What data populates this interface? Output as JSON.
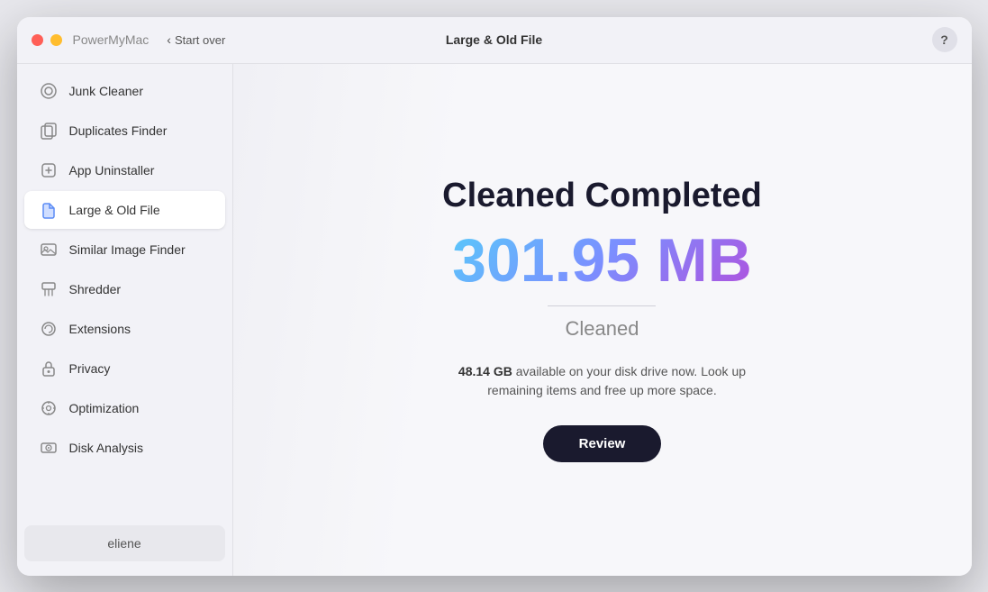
{
  "window": {
    "app_name": "PowerMyMac",
    "title_bar_center": "Large & Old File",
    "start_over_label": "Start over",
    "help_label": "?"
  },
  "sidebar": {
    "items": [
      {
        "id": "junk-cleaner",
        "label": "Junk Cleaner",
        "icon": "🧹",
        "active": false
      },
      {
        "id": "duplicates-finder",
        "label": "Duplicates Finder",
        "icon": "📁",
        "active": false
      },
      {
        "id": "app-uninstaller",
        "label": "App Uninstaller",
        "icon": "🗑️",
        "active": false
      },
      {
        "id": "large-old-file",
        "label": "Large & Old File",
        "icon": "📂",
        "active": true
      },
      {
        "id": "similar-image-finder",
        "label": "Similar Image Finder",
        "icon": "🖼️",
        "active": false
      },
      {
        "id": "shredder",
        "label": "Shredder",
        "icon": "🗜️",
        "active": false
      },
      {
        "id": "extensions",
        "label": "Extensions",
        "icon": "🔌",
        "active": false
      },
      {
        "id": "privacy",
        "label": "Privacy",
        "icon": "🔒",
        "active": false
      },
      {
        "id": "optimization",
        "label": "Optimization",
        "icon": "⚙️",
        "active": false
      },
      {
        "id": "disk-analysis",
        "label": "Disk Analysis",
        "icon": "💾",
        "active": false
      }
    ],
    "user_label": "eliene"
  },
  "main": {
    "heading": "Cleaned Completed",
    "amount": "301.95 MB",
    "cleaned_label": "Cleaned",
    "disk_info_bold": "48.14 GB",
    "disk_info_text": " available on your disk drive now. Look up remaining items and free up more space.",
    "review_button": "Review"
  },
  "icons": {
    "chevron_left": "‹",
    "junk_cleaner": "◎",
    "duplicates_finder": "▦",
    "app_uninstaller": "⊡",
    "large_old_file": "▣",
    "similar_image_finder": "▨",
    "shredder": "▤",
    "extensions": "⊞",
    "privacy": "⊟",
    "optimization": "⊠",
    "disk_analysis": "▰"
  }
}
